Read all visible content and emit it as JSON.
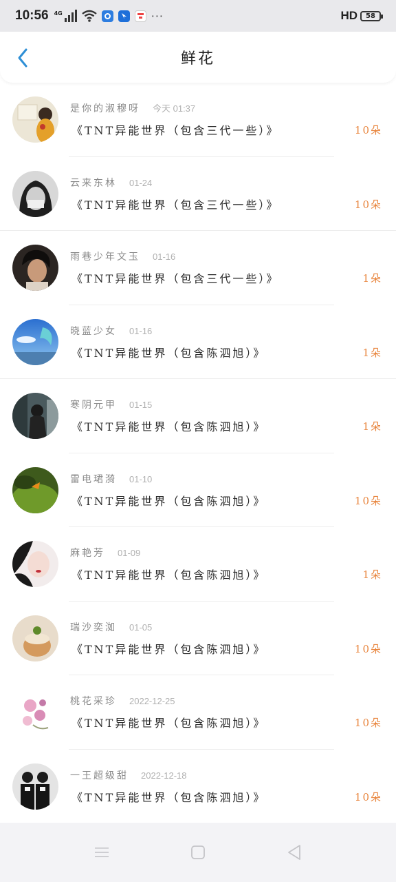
{
  "status_bar": {
    "time": "10:56",
    "network": "4G",
    "hd": "HD",
    "battery": "58",
    "more": "···"
  },
  "header": {
    "title": "鲜花"
  },
  "rows": [
    {
      "name": "是你的淑穆呀",
      "time": "今天 01:37",
      "book": "《TNT异能世界（包含三代一些）》",
      "count": "10朵"
    },
    {
      "name": "云来东林",
      "time": "01-24",
      "book": "《TNT异能世界（包含三代一些）》",
      "count": "10朵"
    },
    {
      "name": "雨巷少年文玉",
      "time": "01-16",
      "book": "《TNT异能世界（包含三代一些）》",
      "count": "1朵"
    },
    {
      "name": "晓蓝少女",
      "time": "01-16",
      "book": "《TNT异能世界（包含陈泗旭）》",
      "count": "1朵"
    },
    {
      "name": "寒阴元甲",
      "time": "01-15",
      "book": "《TNT异能世界（包含陈泗旭）》",
      "count": "1朵"
    },
    {
      "name": "雷电珺漪",
      "time": "01-10",
      "book": "《TNT异能世界（包含陈泗旭）》",
      "count": "10朵"
    },
    {
      "name": "麻艳芳",
      "time": "01-09",
      "book": "《TNT异能世界（包含陈泗旭）》",
      "count": "1朵"
    },
    {
      "name": "瑞沙奕洳",
      "time": "01-05",
      "book": "《TNT异能世界（包含陈泗旭）》",
      "count": "10朵"
    },
    {
      "name": "桃花采珍",
      "time": "2022-12-25",
      "book": "《TNT异能世界（包含陈泗旭）》",
      "count": "10朵"
    },
    {
      "name": "一王超级甜",
      "time": "2022-12-18",
      "book": "《TNT异能世界（包含陈泗旭）》",
      "count": "10朵"
    }
  ],
  "icons": {
    "back": "chevron-left-icon",
    "nav_menu": "menu-icon",
    "nav_home": "square-icon",
    "nav_back": "triangle-back-icon"
  },
  "colors": {
    "accent": "#2e8fd6",
    "count": "#e8843c",
    "name": "#8a8a8a",
    "statusbar_bg": "#e9e9ec",
    "navbar_bg": "#f3f3f6"
  }
}
